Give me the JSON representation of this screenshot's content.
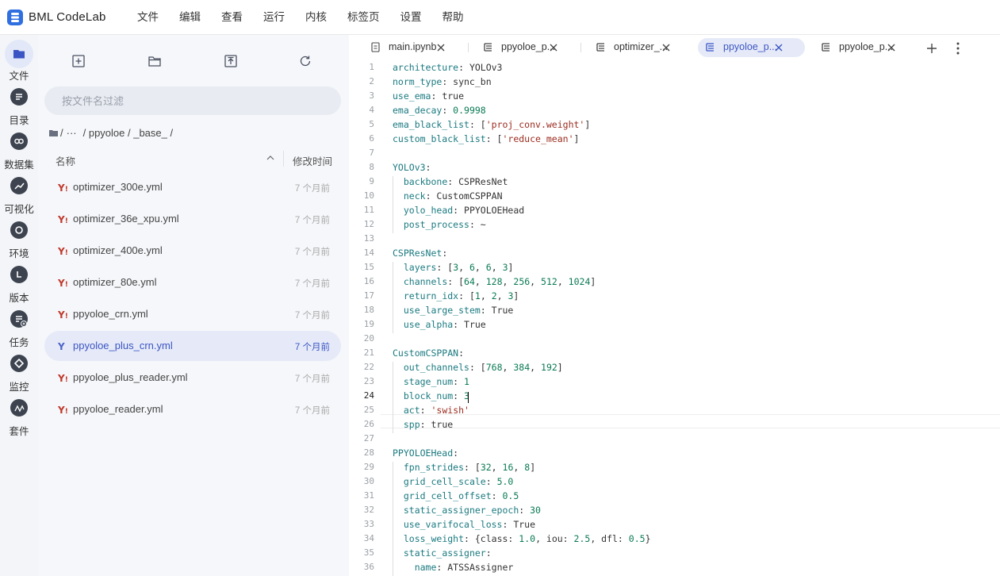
{
  "app": {
    "brand": "BML CodeLab"
  },
  "menu": [
    "文件",
    "编辑",
    "查看",
    "运行",
    "内核",
    "标签页",
    "设置",
    "帮助"
  ],
  "activity": [
    {
      "label": "文件",
      "icon": "folder-icon",
      "selected": true
    },
    {
      "label": "目录",
      "icon": "list-icon"
    },
    {
      "label": "数据集",
      "icon": "dataset-icon"
    },
    {
      "label": "可视化",
      "icon": "chart-icon"
    },
    {
      "label": "环境",
      "icon": "environment-icon"
    },
    {
      "label": "版本",
      "icon": "version-icon"
    },
    {
      "label": "任务",
      "icon": "task-icon"
    },
    {
      "label": "监控",
      "icon": "monitor-icon"
    },
    {
      "label": "套件",
      "icon": "suite-icon"
    }
  ],
  "sidebar": {
    "filter_placeholder": "按文件名过滤",
    "breadcrumb": [
      "/",
      "···",
      "/ ppyoloe / _base_ /"
    ],
    "col_name": "名称",
    "col_time": "修改时间",
    "files": [
      {
        "name": "optimizer_300e.yml",
        "time": "7 个月前"
      },
      {
        "name": "optimizer_36e_xpu.yml",
        "time": "7 个月前"
      },
      {
        "name": "optimizer_400e.yml",
        "time": "7 个月前"
      },
      {
        "name": "optimizer_80e.yml",
        "time": "7 个月前"
      },
      {
        "name": "ppyoloe_crn.yml",
        "time": "7 个月前"
      },
      {
        "name": "ppyoloe_plus_crn.yml",
        "time": "7 个月前",
        "selected": true
      },
      {
        "name": "ppyoloe_plus_reader.yml",
        "time": "7 个月前"
      },
      {
        "name": "ppyoloe_reader.yml",
        "time": "7 个月前"
      }
    ]
  },
  "tabs": [
    {
      "label": "main.ipynb",
      "icon": "notebook-icon"
    },
    {
      "label": "ppyoloe_p...",
      "icon": "file-icon"
    },
    {
      "label": "optimizer_...",
      "icon": "file-icon"
    },
    {
      "label": "ppyoloe_p...",
      "icon": "file-icon",
      "active": true
    },
    {
      "label": "ppyoloe_p...",
      "icon": "file-icon"
    }
  ],
  "editor": {
    "current_line": 24,
    "lines": [
      "architecture: YOLOv3",
      "norm_type: sync_bn",
      "use_ema: true",
      "ema_decay: 0.9998",
      "ema_black_list: ['proj_conv.weight']",
      "custom_black_list: ['reduce_mean']",
      "",
      "YOLOv3:",
      "  backbone: CSPResNet",
      "  neck: CustomCSPPAN",
      "  yolo_head: PPYOLOEHead",
      "  post_process: ~",
      "",
      "CSPResNet:",
      "  layers: [3, 6, 6, 3]",
      "  channels: [64, 128, 256, 512, 1024]",
      "  return_idx: [1, 2, 3]",
      "  use_large_stem: True",
      "  use_alpha: True",
      "",
      "CustomCSPPAN:",
      "  out_channels: [768, 384, 192]",
      "  stage_num: 1",
      "  block_num: 3",
      "  act: 'swish'",
      "  spp: true",
      "",
      "PPYOLOEHead:",
      "  fpn_strides: [32, 16, 8]",
      "  grid_cell_scale: 5.0",
      "  grid_cell_offset: 0.5",
      "  static_assigner_epoch: 30",
      "  use_varifocal_loss: True",
      "  loss_weight: {class: 1.0, iou: 2.5, dfl: 0.5}",
      "  static_assigner:",
      "    name: ATSSAssigner"
    ]
  }
}
